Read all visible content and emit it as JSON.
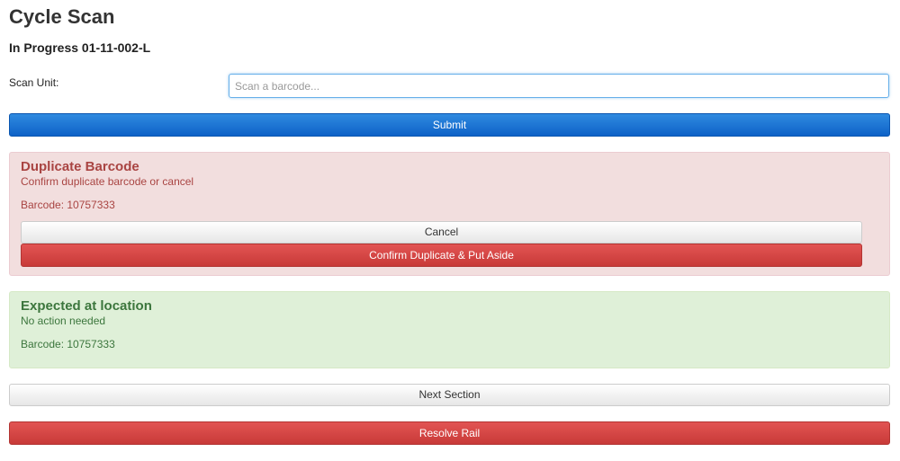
{
  "page": {
    "title": "Cycle Scan",
    "subtitle": "In Progress 01-11-002-L"
  },
  "scan": {
    "label": "Scan Unit:",
    "placeholder": "Scan a barcode...",
    "value": "",
    "submit_label": "Submit"
  },
  "duplicate_alert": {
    "heading": "Duplicate Barcode",
    "message": "Confirm duplicate barcode or cancel",
    "barcode_text": "Barcode: 10757333",
    "cancel_label": "Cancel",
    "confirm_label": "Confirm Duplicate & Put Aside"
  },
  "expected_alert": {
    "heading": "Expected at location",
    "message": "No action needed",
    "barcode_text": "Barcode: 10757333"
  },
  "actions": {
    "next_section_label": "Next Section",
    "resolve_rail_label": "Resolve Rail"
  },
  "colors": {
    "primary": "#0e62c7",
    "danger": "#c83a38",
    "danger_bg": "#f2dede",
    "danger_text": "#a94442",
    "success_bg": "#dff0d8",
    "success_text": "#3c763d"
  }
}
